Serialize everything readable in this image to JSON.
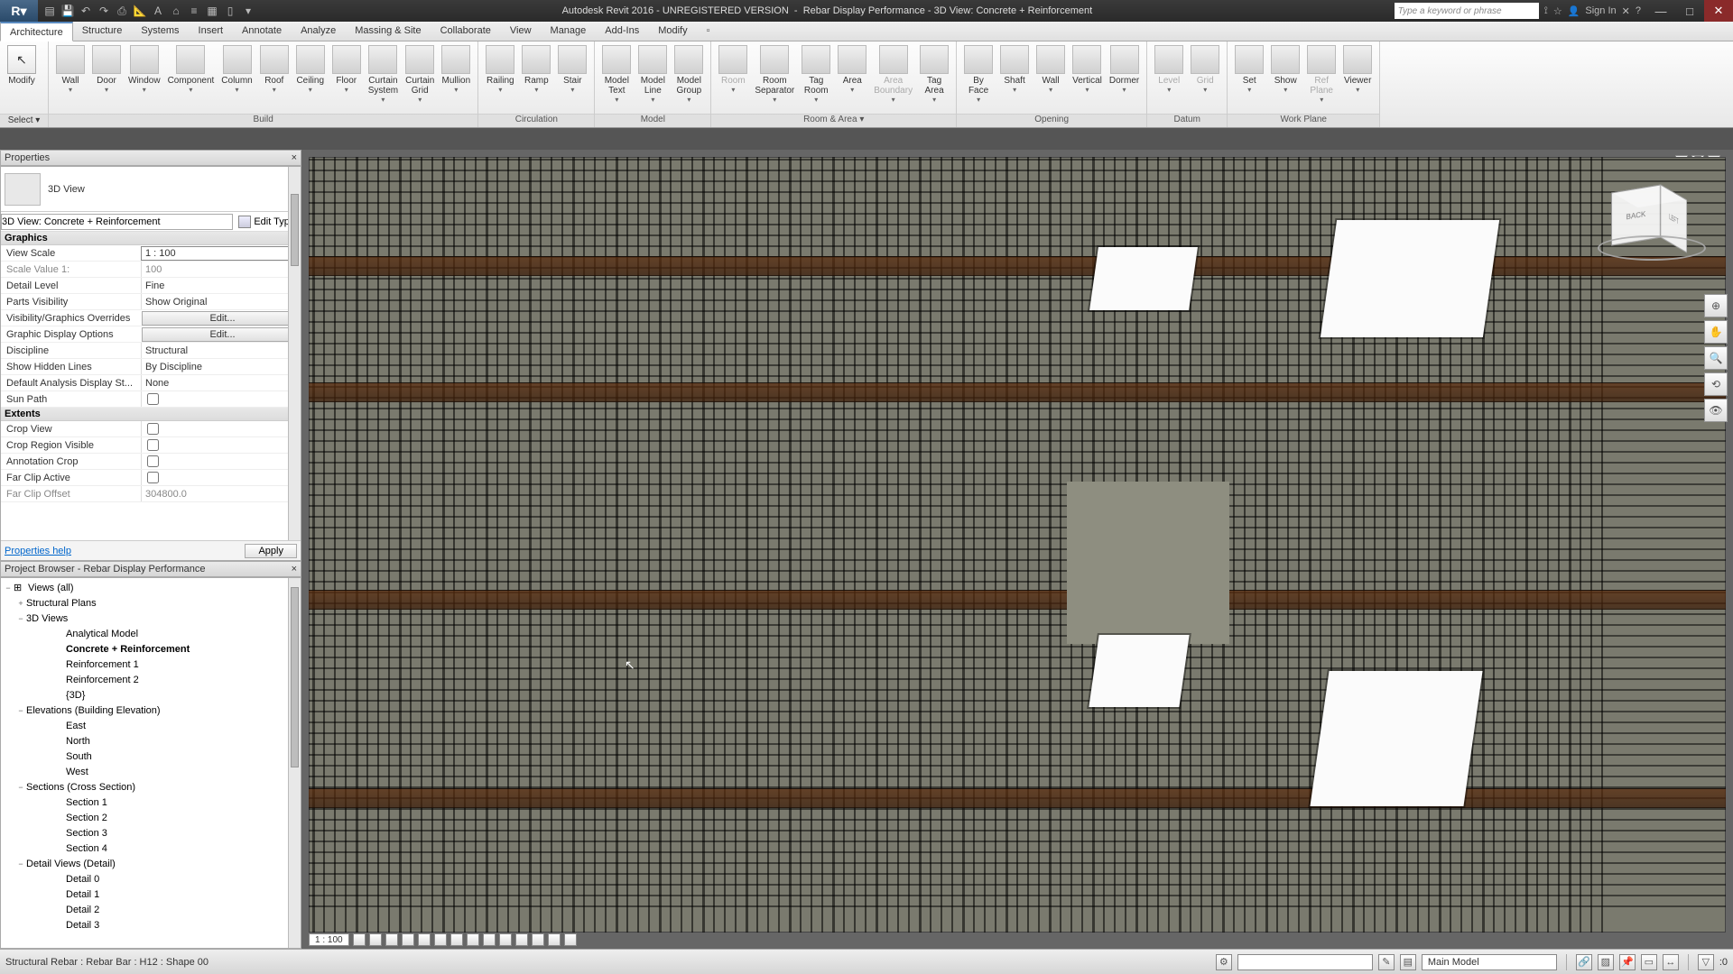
{
  "title": {
    "left": "Autodesk Revit 2016 -  UNREGISTERED VERSION",
    "right": "Rebar Display Performance - 3D View: Concrete + Reinforcement",
    "search_placeholder": "Type a keyword or phrase",
    "sign_in": "Sign In"
  },
  "menutabs": [
    "Architecture",
    "Structure",
    "Systems",
    "Insert",
    "Annotate",
    "Analyze",
    "Massing & Site",
    "Collaborate",
    "View",
    "Manage",
    "Add-Ins",
    "Modify"
  ],
  "menutab_active": 0,
  "ribbon": {
    "select": {
      "button": "Modify",
      "dropdown": "Select ▾"
    },
    "groups": [
      {
        "label": "Build",
        "items": [
          "Wall",
          "Door",
          "Window",
          "Component",
          "Column",
          "Roof",
          "Ceiling",
          "Floor",
          "Curtain\nSystem",
          "Curtain\nGrid",
          "Mullion"
        ]
      },
      {
        "label": "Circulation",
        "items": [
          "Railing",
          "Ramp",
          "Stair"
        ]
      },
      {
        "label": "Model",
        "items": [
          "Model\nText",
          "Model\nLine",
          "Model\nGroup"
        ]
      },
      {
        "label": "Room & Area ▾",
        "items": [
          "Room",
          "Room\nSeparator",
          "Tag\nRoom",
          "Area",
          "Area\nBoundary",
          "Tag\nArea"
        ]
      },
      {
        "label": "Opening",
        "items": [
          "By\nFace",
          "Shaft",
          "Wall",
          "Vertical",
          "Dormer"
        ]
      },
      {
        "label": "Datum",
        "items": [
          "Level",
          "Grid"
        ]
      },
      {
        "label": "Work Plane",
        "items": [
          "Set",
          "Show",
          "Ref\nPlane",
          "Viewer"
        ]
      }
    ],
    "disabled": [
      "Room",
      "Area\nBoundary",
      "Level",
      "Grid",
      "Ref\nPlane"
    ]
  },
  "properties_panel": {
    "title": "Properties",
    "type_name": "3D View",
    "instance_selector": "3D View: Concrete + Reinforcement",
    "edit_type": "Edit Type",
    "sections": [
      {
        "name": "Graphics",
        "rows": [
          {
            "n": "View Scale",
            "v": "1 : 100",
            "boxed": true
          },
          {
            "n": "Scale Value    1:",
            "v": "100",
            "dim": true
          },
          {
            "n": "Detail Level",
            "v": "Fine"
          },
          {
            "n": "Parts Visibility",
            "v": "Show Original"
          },
          {
            "n": "Visibility/Graphics Overrides",
            "v": "Edit...",
            "btn": true
          },
          {
            "n": "Graphic Display Options",
            "v": "Edit...",
            "btn": true
          },
          {
            "n": "Discipline",
            "v": "Structural"
          },
          {
            "n": "Show Hidden Lines",
            "v": "By Discipline"
          },
          {
            "n": "Default Analysis Display St...",
            "v": "None"
          },
          {
            "n": "Sun Path",
            "v": "",
            "check": true
          }
        ]
      },
      {
        "name": "Extents",
        "rows": [
          {
            "n": "Crop View",
            "v": "",
            "check": true
          },
          {
            "n": "Crop Region Visible",
            "v": "",
            "check": true
          },
          {
            "n": "Annotation Crop",
            "v": "",
            "check": true
          },
          {
            "n": "Far Clip Active",
            "v": "",
            "check": true
          },
          {
            "n": "Far Clip Offset",
            "v": "304800.0",
            "dim": true
          }
        ]
      }
    ],
    "help_link": "Properties help",
    "apply": "Apply"
  },
  "browser": {
    "title": "Project Browser - Rebar Display Performance",
    "root": "Views (all)",
    "tree": [
      {
        "label": "Structural Plans",
        "lvl": 1,
        "tog": "+"
      },
      {
        "label": "3D Views",
        "lvl": 1,
        "tog": "−",
        "children": [
          {
            "label": "Analytical Model"
          },
          {
            "label": "Concrete + Reinforcement",
            "bold": true
          },
          {
            "label": "Reinforcement 1"
          },
          {
            "label": "Reinforcement 2"
          },
          {
            "label": "{3D}"
          }
        ]
      },
      {
        "label": "Elevations (Building Elevation)",
        "lvl": 1,
        "tog": "−",
        "children": [
          {
            "label": "East"
          },
          {
            "label": "North"
          },
          {
            "label": "South"
          },
          {
            "label": "West"
          }
        ]
      },
      {
        "label": "Sections (Cross Section)",
        "lvl": 1,
        "tog": "−",
        "children": [
          {
            "label": "Section 1"
          },
          {
            "label": "Section 2"
          },
          {
            "label": "Section 3"
          },
          {
            "label": "Section 4"
          }
        ]
      },
      {
        "label": "Detail Views (Detail)",
        "lvl": 1,
        "tog": "−",
        "children": [
          {
            "label": "Detail 0"
          },
          {
            "label": "Detail 1"
          },
          {
            "label": "Detail 2"
          },
          {
            "label": "Detail 3"
          }
        ]
      }
    ]
  },
  "viewcube": {
    "front": "BACK",
    "right": "LEFT",
    "top": ""
  },
  "view_bottom": {
    "scale": "1 : 100"
  },
  "status": {
    "selection_info": "Structural Rebar : Rebar Bar : H12 : Shape 00",
    "main_model": "Main Model"
  }
}
